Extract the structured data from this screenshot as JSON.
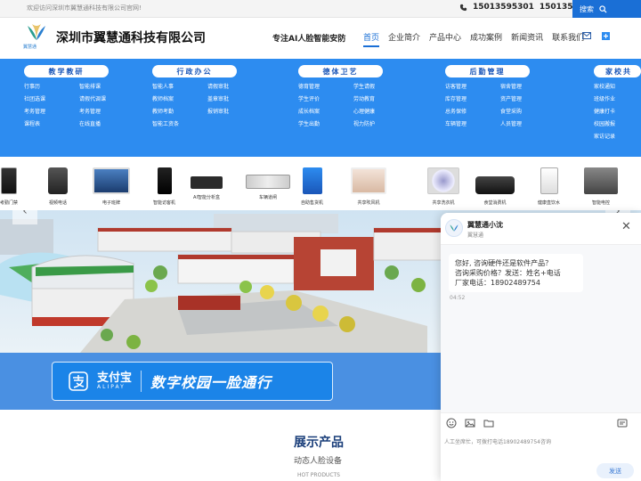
{
  "topbar": {
    "welcome": "欢迎访问深圳市翼慧通科技有限公司官网!",
    "phone1": "15013595301",
    "phone2": "15013595301",
    "search_label": "搜索"
  },
  "header": {
    "logo_text": "翼慧通",
    "company": "深圳市翼慧通科技有限公司",
    "slogan": "专注AI人脸智能安防",
    "nav": [
      "首页",
      "企业简介",
      "产品中心",
      "成功案例",
      "新闻资讯",
      "联系我们"
    ]
  },
  "menu": [
    {
      "title": "教学教研",
      "links": [
        "行事历",
        "智能排课",
        "社团选课",
        "请假代调课",
        "考务管理",
        "考务管理",
        "课程表",
        "在线直播"
      ]
    },
    {
      "title": "行政办公",
      "links": [
        "智能人事",
        "请假审批",
        "教师档案",
        "盖章审批",
        "教师考勤",
        "报销审批",
        "智能工资条",
        ""
      ]
    },
    {
      "title": "德体卫艺",
      "links": [
        "德育管理",
        "学生请假",
        "学生评价",
        "劳动教育",
        "成长档案",
        "心理健康",
        "学生出勤",
        "视力防护"
      ]
    },
    {
      "title": "后勤管理",
      "links": [
        "访客管理",
        "宿舍管理",
        "库存管理",
        "资产管理",
        "总务保修",
        "食堂采购",
        "车辆管理",
        "人员管理"
      ]
    },
    {
      "title": "家校共",
      "links": [
        "家校通知",
        "",
        "班级作业",
        "",
        "健康打卡",
        "",
        "校园搬报",
        "",
        "家访记录",
        ""
      ]
    }
  ],
  "products": [
    "考勤门禁",
    "视频电话",
    "电子班牌",
    "智能访客机",
    "AI智能分析盒",
    "车辆道闸",
    "自助售货机",
    "共享吹风机",
    "共享洗衣机",
    "食堂消费机",
    "健康直饮水",
    "智能电控"
  ],
  "banner": {
    "alipay_cn": "支付宝",
    "alipay_en": "ALIPAY",
    "slogan": "数字校园一脸通行"
  },
  "section": {
    "title": "展示产品",
    "subtitle": "动态人脸设备",
    "en": "HOT PRODUCTS"
  },
  "chat": {
    "name": "翼慧通小沈",
    "org": "翼慧通",
    "avatar_text": "翼慧通",
    "message_lines": [
      "您好, 咨询硬件还是软件产品？",
      "咨询采购价格？发送：姓名+电话",
      "厂家电话：18902489754"
    ],
    "time": "04:52",
    "placeholder": "人工坐席忙，可拨打电话18902489754咨询",
    "send_label": "发送"
  },
  "colors": {
    "brand_blue": "#2d8cf0",
    "dark_blue": "#1a6fd6",
    "title_navy": "#1a3e7a"
  }
}
